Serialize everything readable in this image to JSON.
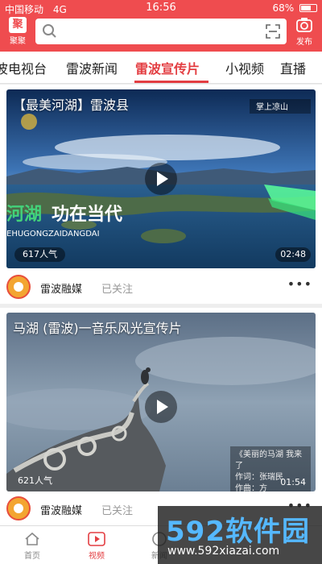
{
  "status_bar": {
    "carrier": "中国移动",
    "network": "4G",
    "time": "16:56",
    "battery_text": "68%",
    "battery_level": 0.68
  },
  "header": {
    "left_label": "聚聚",
    "right_label": "发布"
  },
  "tabs": [
    {
      "label": "波电视台",
      "active": false
    },
    {
      "label": "雷波新闻",
      "active": false
    },
    {
      "label": "雷波宣传片",
      "active": true
    },
    {
      "label": "小视频",
      "active": false
    },
    {
      "label": "直播",
      "active": false
    }
  ],
  "videos": [
    {
      "title": "【最美河湖】雷波县",
      "views": "617人气",
      "duration": "02:48",
      "overlay_big": "河湖  功在当代",
      "overlay_pinyin": "EHUGONGZAIDANGDAI",
      "logo_text": "掌上凉山",
      "source": "雷波融媒",
      "follow_status": "已关注"
    },
    {
      "title": "马湖 (雷波)一音乐风光宣传片",
      "views": "621人气",
      "duration": "01:54",
      "overlay_lines": [
        "《美丽的马湖  我来了",
        "作词：张瑞民",
        "作曲：方"
      ],
      "source": "雷波融媒",
      "follow_status": "已关注"
    }
  ],
  "bottom_nav": [
    {
      "label": "首页",
      "icon": "home-icon",
      "active": false
    },
    {
      "label": "视频",
      "icon": "video-icon",
      "active": true
    },
    {
      "label": "新闻",
      "icon": "news-icon",
      "active": false
    }
  ],
  "watermark": {
    "main": "592软件园",
    "sub": "www.592xiazai.com"
  },
  "colors": {
    "brand_red": "#ef4c4f",
    "active_tab": "#e33e42"
  }
}
